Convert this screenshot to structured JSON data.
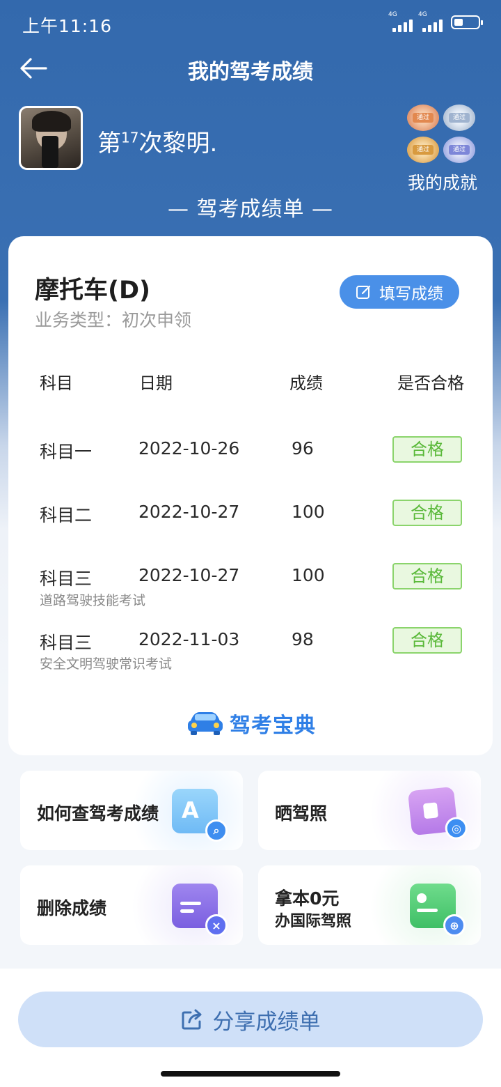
{
  "status_bar": {
    "time": "上午11:16",
    "network1": "4G",
    "network2": "4G"
  },
  "header": {
    "title": "我的驾考成绩"
  },
  "profile": {
    "name_prefix": "第",
    "name_sup": "17",
    "name_suffix": "次黎明.",
    "achievements_label": "我的成就"
  },
  "section_label": "— 驾考成绩单 —",
  "card": {
    "vehicle": "摩托车(D)",
    "business_type": "业务类型：初次申领",
    "fill_button": "填写成绩",
    "columns": [
      "科目",
      "日期",
      "成绩",
      "是否合格"
    ],
    "rows": [
      {
        "subject": "科目一",
        "date": "2022-10-26",
        "score": "96",
        "result": "合格",
        "note": ""
      },
      {
        "subject": "科目二",
        "date": "2022-10-27",
        "score": "100",
        "result": "合格",
        "note": ""
      },
      {
        "subject": "科目三",
        "date": "2022-10-27",
        "score": "100",
        "result": "合格",
        "note": "道路驾驶技能考试"
      },
      {
        "subject": "科目三",
        "date": "2022-11-03",
        "score": "98",
        "result": "合格",
        "note": "安全文明驾驶常识考试"
      }
    ],
    "brand": "驾考宝典"
  },
  "tiles": [
    {
      "label": "如何查驾考成绩",
      "icon": "search-doc-icon"
    },
    {
      "label": "晒驾照",
      "icon": "photo-camera-icon"
    },
    {
      "label": "删除成绩",
      "icon": "delete-doc-icon"
    },
    {
      "label_line1": "拿本0元",
      "label_line2": "办国际驾照",
      "icon": "id-card-globe-icon"
    }
  ],
  "share_button": "分享成绩单",
  "colors": {
    "header_blue": "#3369ad",
    "accent_blue": "#4a90e8",
    "pass_green": "#5ab93a"
  }
}
